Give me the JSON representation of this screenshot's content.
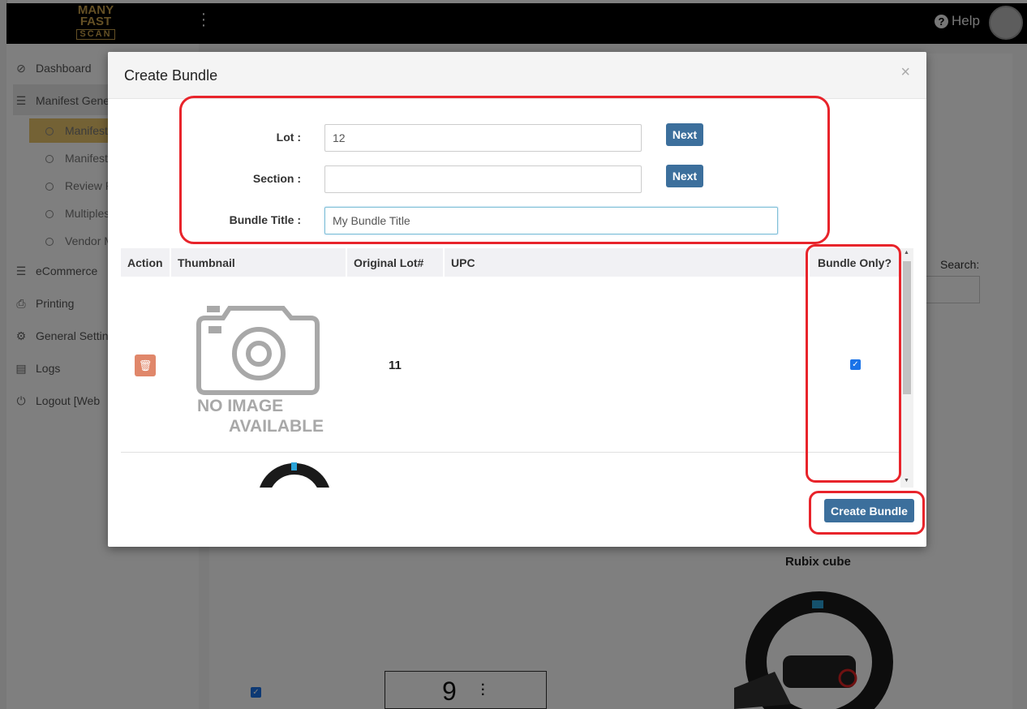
{
  "app": {
    "logo_lines": [
      "MANY",
      "FAST",
      "SCAN"
    ],
    "help_label": "Help",
    "sidebar": {
      "items": [
        {
          "label": "Dashboard",
          "icon": "dashboard-icon"
        },
        {
          "label": "Manifest Gene",
          "icon": "list-icon"
        },
        {
          "label": "eCommerce",
          "icon": "list-icon"
        },
        {
          "label": "Printing",
          "icon": "printer-icon"
        },
        {
          "label": "General Settin",
          "icon": "gears-icon"
        },
        {
          "label": "Logs",
          "icon": "logs-icon"
        },
        {
          "label": "Logout [Web",
          "icon": "power-icon"
        }
      ],
      "subitems": [
        "Manifest",
        "Manifest",
        "Review P",
        "Multiples",
        "Vendor M"
      ]
    },
    "search_label": "Search:",
    "product_title": "Rubix cube",
    "counter_value": "9"
  },
  "modal": {
    "title": "Create Bundle",
    "close_label": "×",
    "form": {
      "lot_label": "Lot :",
      "lot_value": "12",
      "section_label": "Section :",
      "section_value": "",
      "bundle_title_label": "Bundle Title :",
      "bundle_title_value": "My Bundle Title",
      "next_label": "Next"
    },
    "table": {
      "headers": [
        "Action",
        "Thumbnail",
        "Original Lot#",
        "UPC",
        "Bundle Only?"
      ],
      "rows": [
        {
          "original_lot": "11",
          "upc": "",
          "bundle_only": true,
          "no_image_line1": "NO IMAGE",
          "no_image_line2": "AVAILABLE"
        }
      ]
    },
    "create_label": "Create Bundle"
  },
  "colors": {
    "primary_button": "#3c6f9c",
    "delete_button": "#e0876a",
    "highlight": "#e8242b",
    "sidebar_active": "#e8c46a"
  }
}
